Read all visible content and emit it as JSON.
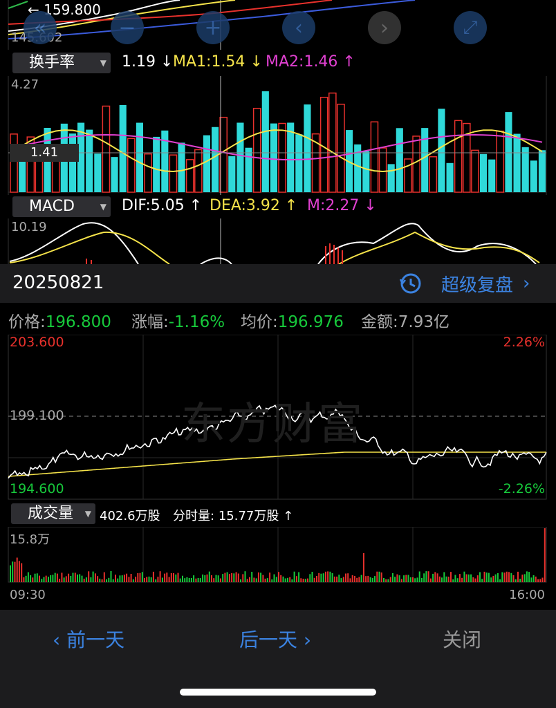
{
  "top": {
    "price_label": "159.800",
    "low_label": "145.602",
    "toolbar": [
      "«",
      "−",
      "+",
      "‹",
      "›",
      "⤢"
    ]
  },
  "turnover": {
    "selector": "换手率",
    "value": "1.19",
    "value_arrow": "↓",
    "ma1": "MA1:1.54",
    "ma1_arrow": "↓",
    "ma2": "MA2:1.46",
    "ma2_arrow": "↑",
    "axis_max": "4.27",
    "cursor_value": "1.41"
  },
  "macd": {
    "selector": "MACD",
    "dif": "DIF:5.05",
    "dif_arrow": "↑",
    "dea": "DEA:3.92",
    "dea_arrow": "↑",
    "m": "M:2.27",
    "m_arrow": "↓",
    "axis_max": "10.19"
  },
  "day": {
    "date": "20250821",
    "replay_label": "超级复盘",
    "price_key": "价格:",
    "price": "196.800",
    "change_key": "涨幅:",
    "change": "-1.16%",
    "avg_key": "均价:",
    "avg": "196.976",
    "amount_key": "金额:",
    "amount": "7.93亿"
  },
  "intraday": {
    "high": "203.600",
    "high_pct": "2.26%",
    "prev_close": "199.100",
    "low": "194.600",
    "low_pct": "-2.26%",
    "watermark": "东方财富"
  },
  "volume": {
    "selector": "成交量",
    "total": "402.6万股",
    "minute_key": "分时量:",
    "minute": "15.77万股",
    "minute_arrow": "↑",
    "axis_max": "15.8万",
    "start_time": "09:30",
    "end_time": "16:00"
  },
  "nav": {
    "prev": "前一天",
    "next": "后一天",
    "close": "关闭"
  },
  "colors": {
    "up": "#e8312c",
    "down": "#2fd9d9",
    "green": "#17c93b",
    "yellow": "#f5e34a",
    "magenta": "#e040d0",
    "blue": "#3b82e0"
  }
}
